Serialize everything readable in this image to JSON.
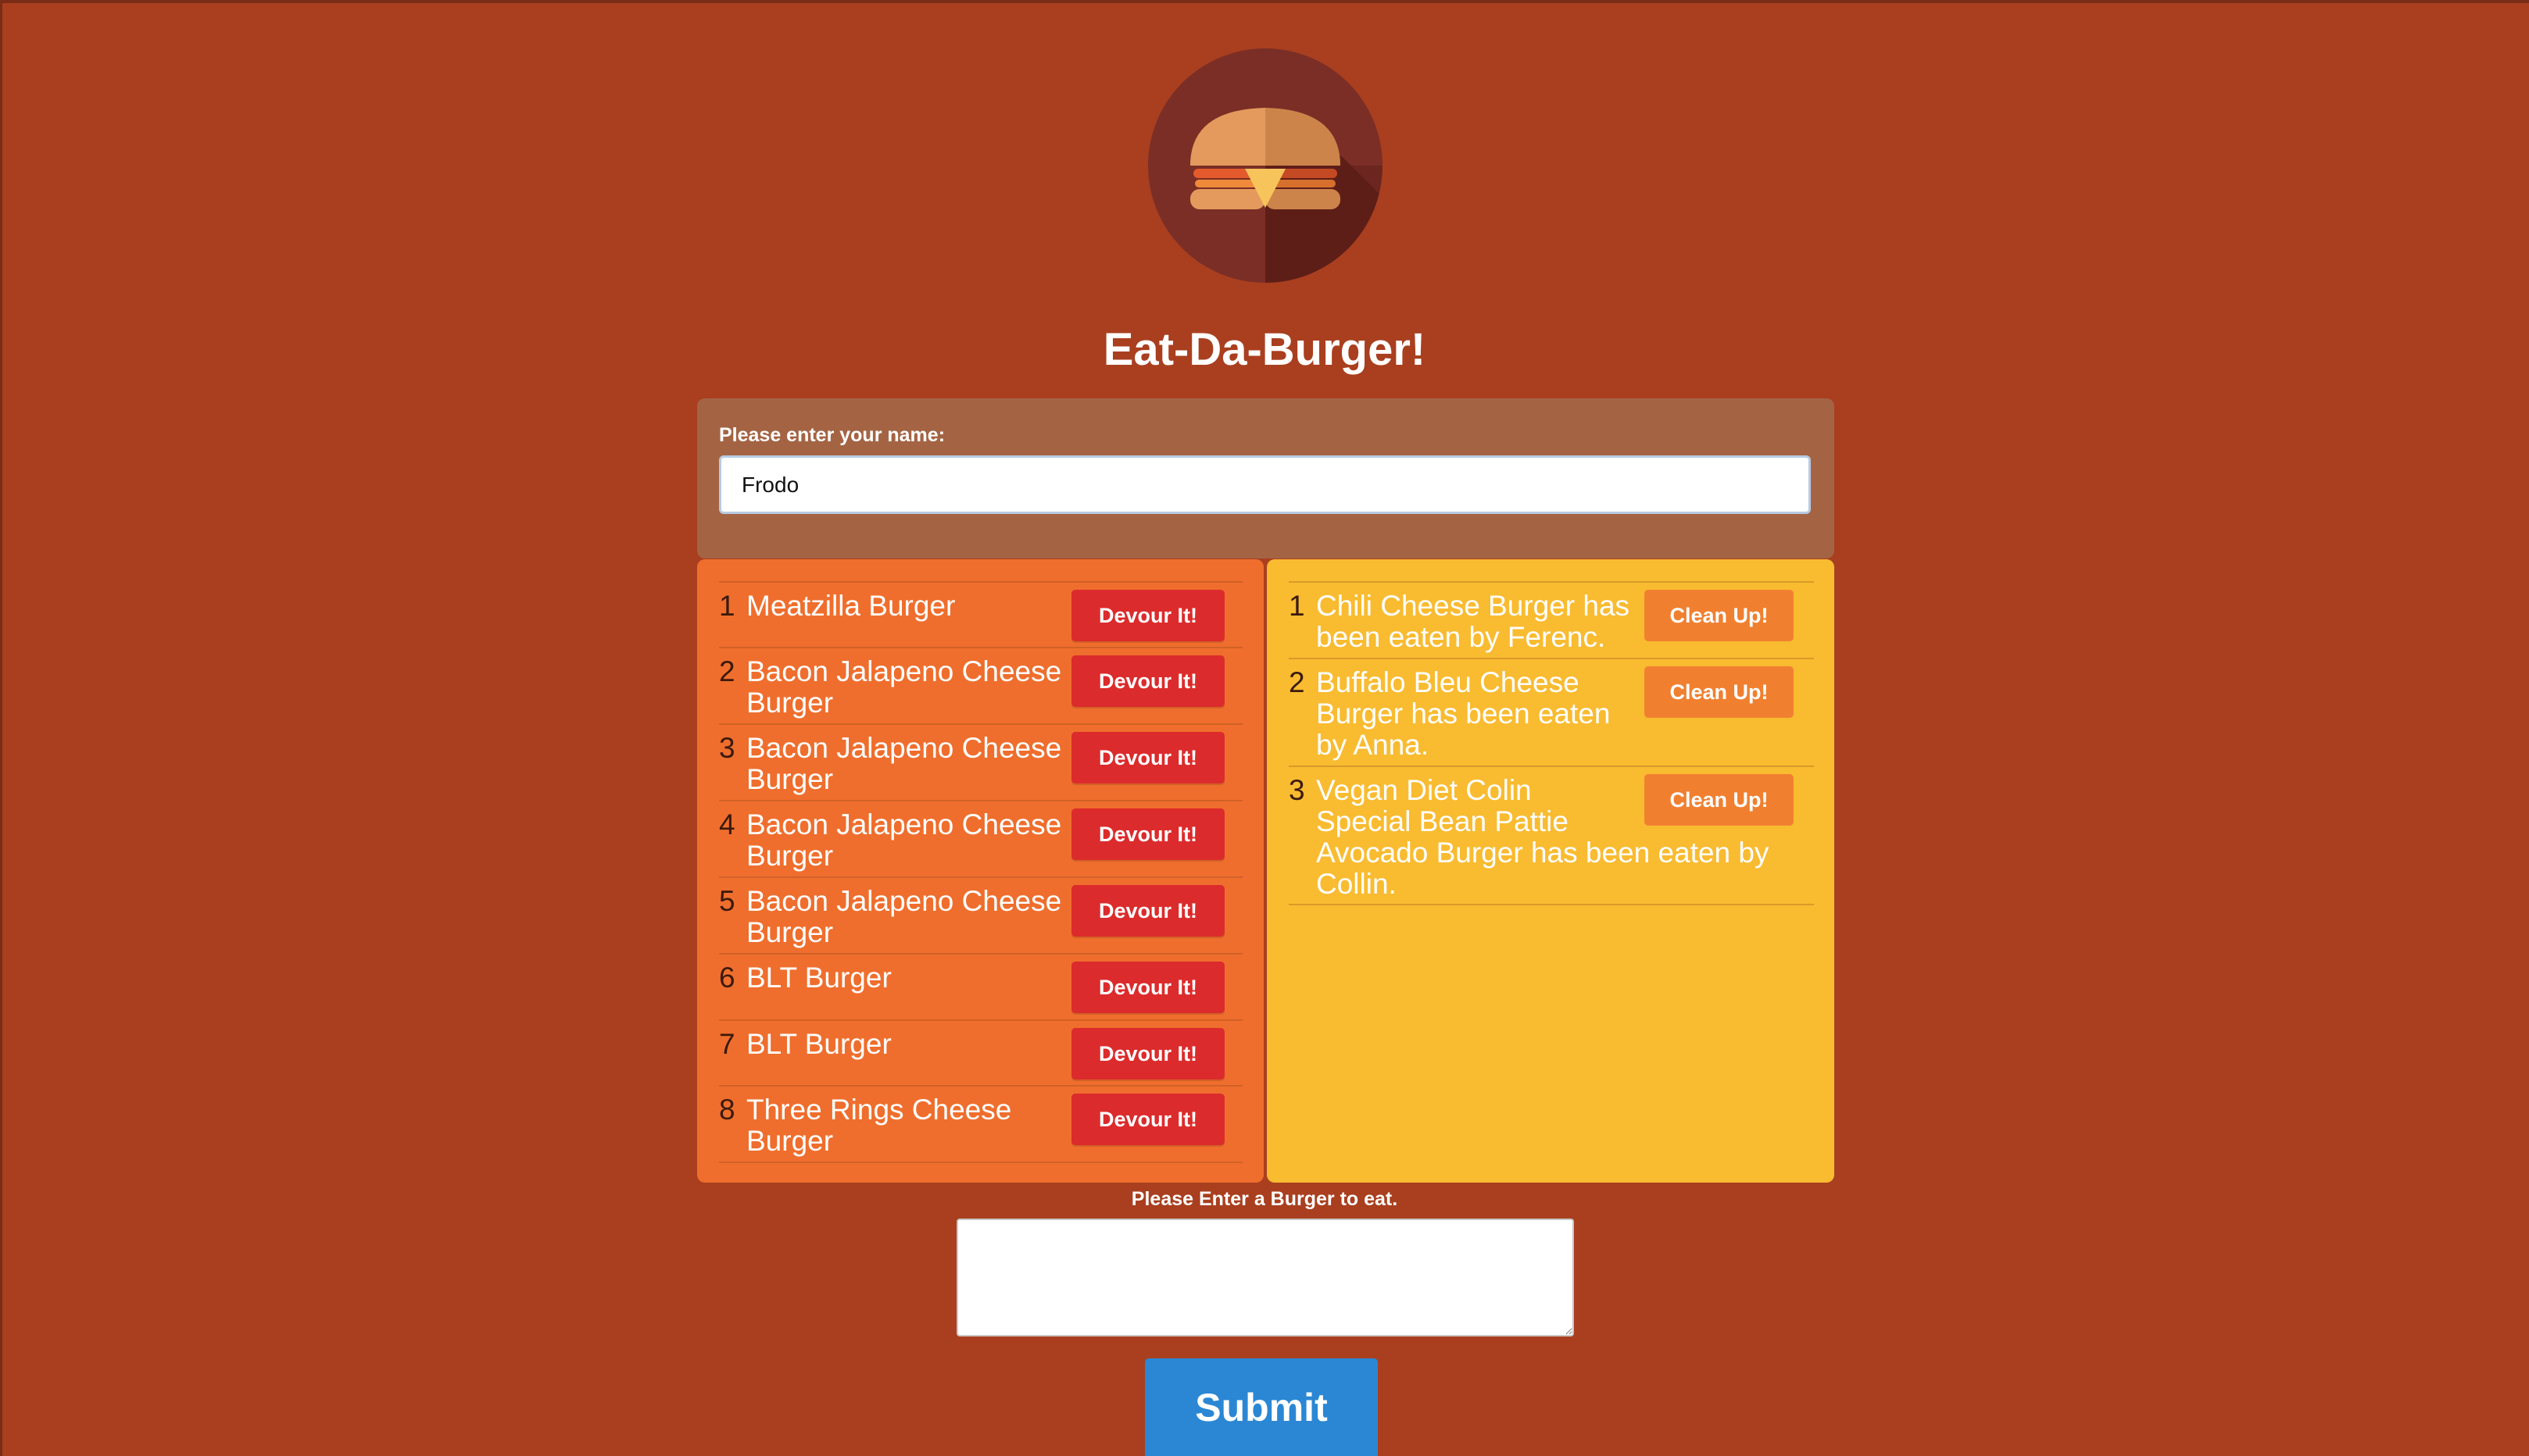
{
  "app": {
    "title": "Eat-Da-Burger!",
    "logo_icon": "burger-icon"
  },
  "name_form": {
    "label": "Please enter your name:",
    "value": "Frodo",
    "placeholder": ""
  },
  "uneaten": {
    "button_label": "Devour It!",
    "items": [
      {
        "num": "1",
        "name": "Meatzilla Burger"
      },
      {
        "num": "2",
        "name": "Bacon Jalapeno Cheese Burger"
      },
      {
        "num": "3",
        "name": "Bacon Jalapeno Cheese Burger"
      },
      {
        "num": "4",
        "name": "Bacon Jalapeno Cheese Burger"
      },
      {
        "num": "5",
        "name": "Bacon Jalapeno Cheese Burger"
      },
      {
        "num": "6",
        "name": "BLT Burger"
      },
      {
        "num": "7",
        "name": "BLT Burger"
      },
      {
        "num": "8",
        "name": "Three Rings Cheese Burger"
      }
    ]
  },
  "eaten": {
    "button_label": "Clean Up!",
    "items": [
      {
        "num": "1",
        "text": "Chili Cheese Burger has been eaten by Ferenc."
      },
      {
        "num": "2",
        "text": "Buffalo Bleu Cheese Burger has been eaten by Anna."
      },
      {
        "num": "3",
        "text": "Vegan Diet Colin Special Bean Pattie Avocado Burger has been eaten by Collin."
      }
    ]
  },
  "add_form": {
    "label": "Please Enter a Burger to eat.",
    "value": "",
    "submit_label": "Submit"
  },
  "colors": {
    "page_background": "#a93f1f",
    "name_panel": "#a46444",
    "uneaten_column": "#ef6e2d",
    "eaten_column": "#f9bb30",
    "devour_button": "#dc2b2c",
    "clean_button": "#f08030",
    "submit_button": "#2b87d4"
  }
}
